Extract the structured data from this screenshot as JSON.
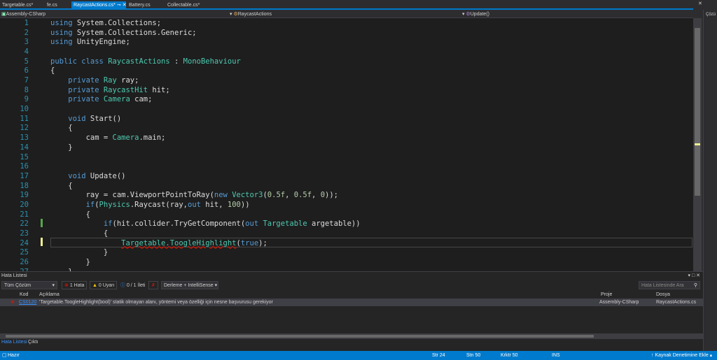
{
  "tabs": [
    {
      "label": "Targetable.cs*"
    },
    {
      "label": "fe.cs"
    },
    {
      "label": "RaycastActions.cs*",
      "active": true
    },
    {
      "label": "Battery.cs"
    },
    {
      "label": "Collectable.cs*"
    }
  ],
  "nav": {
    "project": "Assembly-CSharp",
    "class": "RaycastActions",
    "member": "Update()"
  },
  "code": [
    [
      [
        "using",
        "kw"
      ],
      [
        " System.Collections;",
        ""
      ]
    ],
    [
      [
        "using",
        "kw"
      ],
      [
        " System.Collections.Generic;",
        ""
      ]
    ],
    [
      [
        "using",
        "kw"
      ],
      [
        " UnityEngine;",
        ""
      ]
    ],
    [],
    [
      [
        "public class ",
        "kw"
      ],
      [
        "RaycastActions",
        "ty"
      ],
      [
        " : ",
        ""
      ],
      [
        "MonoBehaviour",
        "ty"
      ]
    ],
    [
      [
        "{",
        ""
      ]
    ],
    [
      [
        "    private ",
        "kw"
      ],
      [
        "Ray",
        "ty"
      ],
      [
        " ray;",
        ""
      ]
    ],
    [
      [
        "    private ",
        "kw"
      ],
      [
        "RaycastHit",
        "ty"
      ],
      [
        " hit;",
        ""
      ]
    ],
    [
      [
        "    private ",
        "kw"
      ],
      [
        "Camera",
        "ty"
      ],
      [
        " cam;",
        ""
      ]
    ],
    [],
    [
      [
        "    void ",
        "kw"
      ],
      [
        "Start()",
        ""
      ]
    ],
    [
      [
        "    {",
        ""
      ]
    ],
    [
      [
        "        cam = ",
        ""
      ],
      [
        "Camera",
        "ty"
      ],
      [
        ".main;",
        ""
      ]
    ],
    [
      [
        "    }",
        ""
      ]
    ],
    [],
    [],
    [
      [
        "    void ",
        "kw"
      ],
      [
        "Update()",
        ""
      ]
    ],
    [
      [
        "    {",
        ""
      ]
    ],
    [
      [
        "        ray = cam.ViewportPointToRay(",
        ""
      ],
      [
        "new ",
        "kw"
      ],
      [
        "Vector3",
        "ty"
      ],
      [
        "(",
        ""
      ],
      [
        "0.5f",
        "nu"
      ],
      [
        ", ",
        ""
      ],
      [
        "0.5f",
        "nu"
      ],
      [
        ", ",
        ""
      ],
      [
        "0",
        "nu"
      ],
      [
        "));",
        ""
      ]
    ],
    [
      [
        "        if",
        "kw"
      ],
      [
        "(",
        ""
      ],
      [
        "Physics",
        "ty"
      ],
      [
        ".Raycast(ray,",
        ""
      ],
      [
        "out",
        "kw"
      ],
      [
        " hit, ",
        ""
      ],
      [
        "100",
        "nu"
      ],
      [
        "))",
        ""
      ]
    ],
    [
      [
        "        {",
        ""
      ]
    ],
    [
      [
        "            if",
        "kw"
      ],
      [
        "(hit.collider.TryGetComponent(",
        ""
      ],
      [
        "out ",
        "kw"
      ],
      [
        "Targetable",
        "ty"
      ],
      [
        " argetable))",
        ""
      ]
    ],
    [
      [
        "            {",
        ""
      ]
    ],
    [
      [
        "                ",
        ""
      ],
      [
        "Targetable.ToogleHighlight",
        "ty err"
      ],
      [
        "(",
        ""
      ],
      [
        "true",
        "kw"
      ],
      [
        ");",
        ""
      ]
    ],
    [
      [
        "            }",
        ""
      ]
    ],
    [
      [
        "        }",
        ""
      ]
    ],
    [
      [
        "    }",
        ""
      ]
    ]
  ],
  "errorlist": {
    "title": "Hata Listesi",
    "scope": "Tüm Çözüm",
    "errors": "1 Hata",
    "warnings": "0 Uyarı",
    "messages": "0 / 1 İleti",
    "filter": "Derleme + IntelliSense",
    "search_placeholder": "Hata Listesinde Ara",
    "columns": {
      "code": "Kod",
      "desc": "Açıklama",
      "project": "Proje",
      "file": "Dosya"
    },
    "rows": [
      {
        "code": "CS0120",
        "desc": "'Targetable.ToogleHighlight(bool)' statik olmayan alanı, yöntemi veya özelliği için nesne başvurusu gerekiyor",
        "project": "Assembly-CSharp",
        "file": "RaycastActions.cs"
      }
    ],
    "tabs": [
      "Hata Listesi",
      "Çıktı"
    ]
  },
  "status": {
    "ready": "Hazır",
    "line": "Str 24",
    "col": "Stn 50",
    "char": "Krktr 50",
    "mode": "INS",
    "source_control": "Kaynak Denetimine Ekle"
  },
  "side": {
    "label": "Çözü"
  }
}
